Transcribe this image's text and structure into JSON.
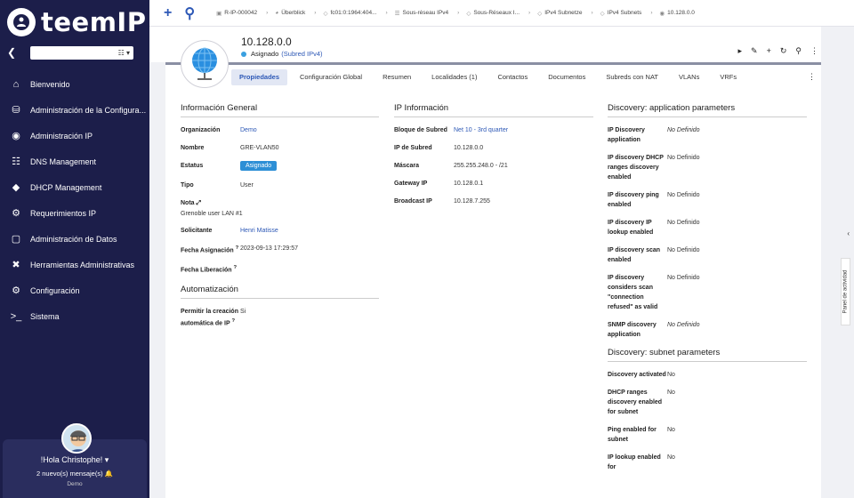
{
  "sidebar": {
    "logo": "teemIP",
    "org_select": "",
    "nav": [
      {
        "icon": "home-icon",
        "label": "Bienvenido"
      },
      {
        "icon": "database-icon",
        "label": "Administración de la Configura..."
      },
      {
        "icon": "globe-icon",
        "label": "Administración IP"
      },
      {
        "icon": "sitemap-icon",
        "label": "DNS Management"
      },
      {
        "icon": "dhcp-icon",
        "label": "DHCP Management"
      },
      {
        "icon": "users-cog-icon",
        "label": "Requerimientos IP"
      },
      {
        "icon": "folder-icon",
        "label": "Administración de Datos"
      },
      {
        "icon": "tools-icon",
        "label": "Herramientas Administrativas"
      },
      {
        "icon": "gear-icon",
        "label": "Configuración"
      },
      {
        "icon": "terminal-icon",
        "label": "Sistema"
      }
    ],
    "user": {
      "greeting": "!Hola Christophe!",
      "messages": "2 nuevo(s) mensaje(s)",
      "org": "Demo"
    }
  },
  "breadcrumbs": [
    "R-IP-000042",
    "Überblick",
    "fc01:0:1964:404...",
    "Sous-réseau IPv4",
    "Sous-Réseaux I...",
    "IPv4 Subnetze",
    "IPv4 Subnets",
    "10.128.0.0"
  ],
  "object": {
    "title": "10.128.0.0",
    "status": "Asignado",
    "subclass": "(Subred IPv4)"
  },
  "tabs": [
    {
      "label": "Propiedades",
      "active": true
    },
    {
      "label": "Configuración Global",
      "active": false
    },
    {
      "label": "Resumen",
      "active": false
    },
    {
      "label": "Localidades (1)",
      "active": false
    },
    {
      "label": "Contactos",
      "active": false
    },
    {
      "label": "Documentos",
      "active": false
    },
    {
      "label": "Subreds con NAT",
      "active": false
    },
    {
      "label": "VLANs",
      "active": false
    },
    {
      "label": "VRFs",
      "active": false
    }
  ],
  "general": {
    "title": "Información General",
    "org_label": "Organización",
    "org_value": "Demo",
    "name_label": "Nombre",
    "name_value": "GRE-VLAN50",
    "status_label": "Estatus",
    "status_value": "Asignado",
    "type_label": "Tipo",
    "type_value": "User",
    "note_label": "Nota",
    "note_value": "Grenoble user LAN #1",
    "requestor_label": "Solicitante",
    "requestor_value": "Henri Matisse",
    "alloc_label": "Fecha Asignación",
    "alloc_value": "2023-09-13 17:29:57",
    "release_label": "Fecha Liberación",
    "release_value": "",
    "auto_title": "Automatización",
    "auto_label": "Permitir la creación automática de IP",
    "auto_value": "Si"
  },
  "ipinfo": {
    "title": "IP Información",
    "block_label": "Bloque de Subred",
    "block_value": "Net 10 - 3rd quarter",
    "ip_label": "IP de Subred",
    "ip_value": "10.128.0.0",
    "mask_label": "Máscara",
    "mask_value": "255.255.248.0 - /21",
    "gw_label": "Gateway IP",
    "gw_value": "10.128.0.1",
    "bc_label": "Broadcast IP",
    "bc_value": "10.128.7.255"
  },
  "discovery": {
    "app_title": "Discovery: application parameters",
    "app_rows": [
      {
        "label": "IP Discovery application",
        "value": "No Definido",
        "italic": true
      },
      {
        "label": "IP discovery DHCP ranges discovery enabled",
        "value": "No Definido",
        "italic": false
      },
      {
        "label": "IP discovery ping enabled",
        "value": "No Definido",
        "italic": false
      },
      {
        "label": "IP discovery IP lookup enabled",
        "value": "No Definido",
        "italic": false
      },
      {
        "label": "IP discovery scan enabled",
        "value": "No Definido",
        "italic": false
      },
      {
        "label": "IP discovery considers scan \"connection refused\" as valid",
        "value": "No Definido",
        "italic": false
      },
      {
        "label": "SNMP discovery application",
        "value": "No Definido",
        "italic": true
      }
    ],
    "subnet_title": "Discovery: subnet parameters",
    "subnet_rows": [
      {
        "label": "Discovery activated",
        "value": "No"
      },
      {
        "label": "DHCP ranges discovery enabled for subnet",
        "value": "No"
      },
      {
        "label": "Ping enabled for subnet",
        "value": "No"
      },
      {
        "label": "IP lookup enabled for",
        "value": "No"
      }
    ]
  },
  "right_panel": {
    "label": "Panel de actividad"
  },
  "colors": {
    "sidebar": "#1c1e4a",
    "accent": "#2d58b6",
    "status": "#3aa0e0"
  }
}
